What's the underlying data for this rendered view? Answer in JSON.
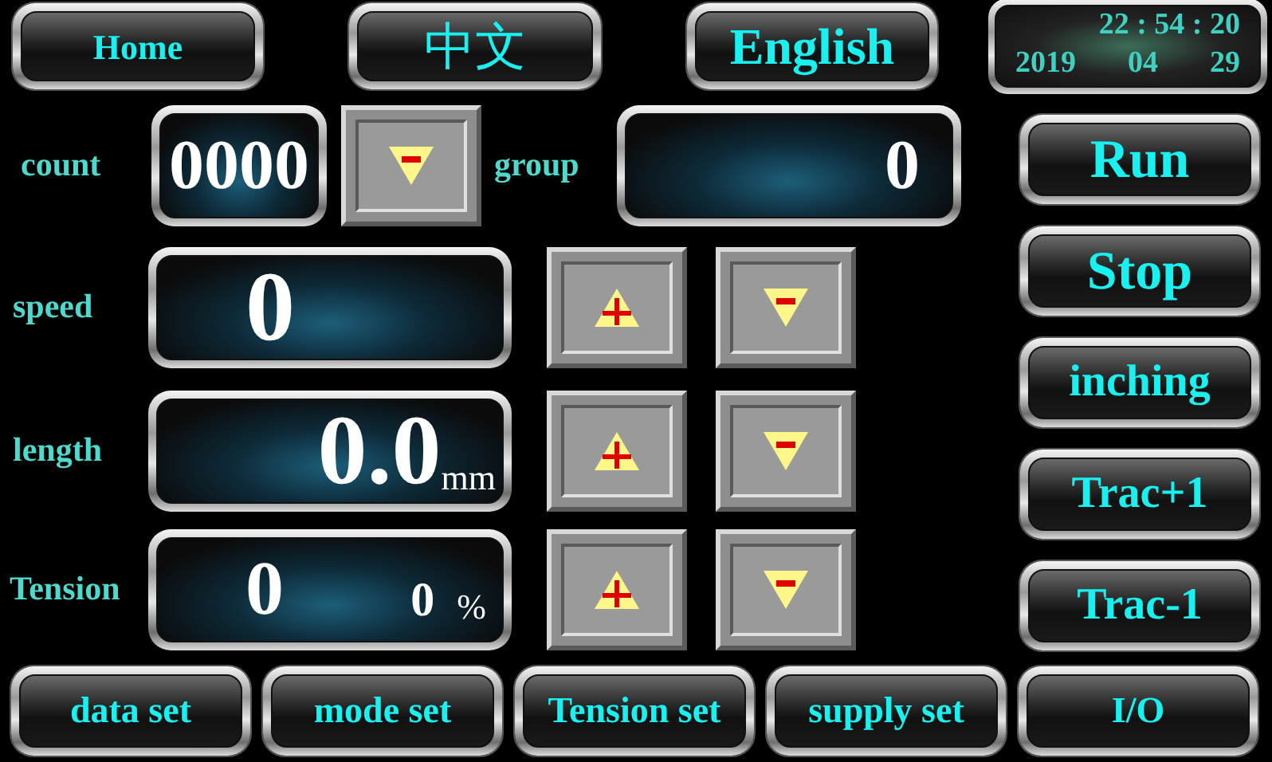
{
  "top_buttons": [
    {
      "label": "Home"
    },
    {
      "label": "中文"
    },
    {
      "label": "English"
    }
  ],
  "clock": {
    "time": "22 : 54 : 20",
    "date": [
      "2019",
      "04",
      "29"
    ]
  },
  "count": {
    "label": "count",
    "value": "0000"
  },
  "group": {
    "label": "group",
    "value": "0"
  },
  "rows": [
    {
      "label": "speed",
      "value": "0"
    },
    {
      "label": "length",
      "value": "0.0",
      "unit": "mm"
    },
    {
      "label": "Tension",
      "value": "0",
      "secondary_value": "0",
      "unit": "%"
    }
  ],
  "side_buttons": [
    "Run",
    "Stop",
    "inching",
    "Trac+1",
    "Trac-1"
  ],
  "bottom_buttons": [
    "data set",
    "mode set",
    "Tension set",
    "supply set",
    "I/O"
  ]
}
